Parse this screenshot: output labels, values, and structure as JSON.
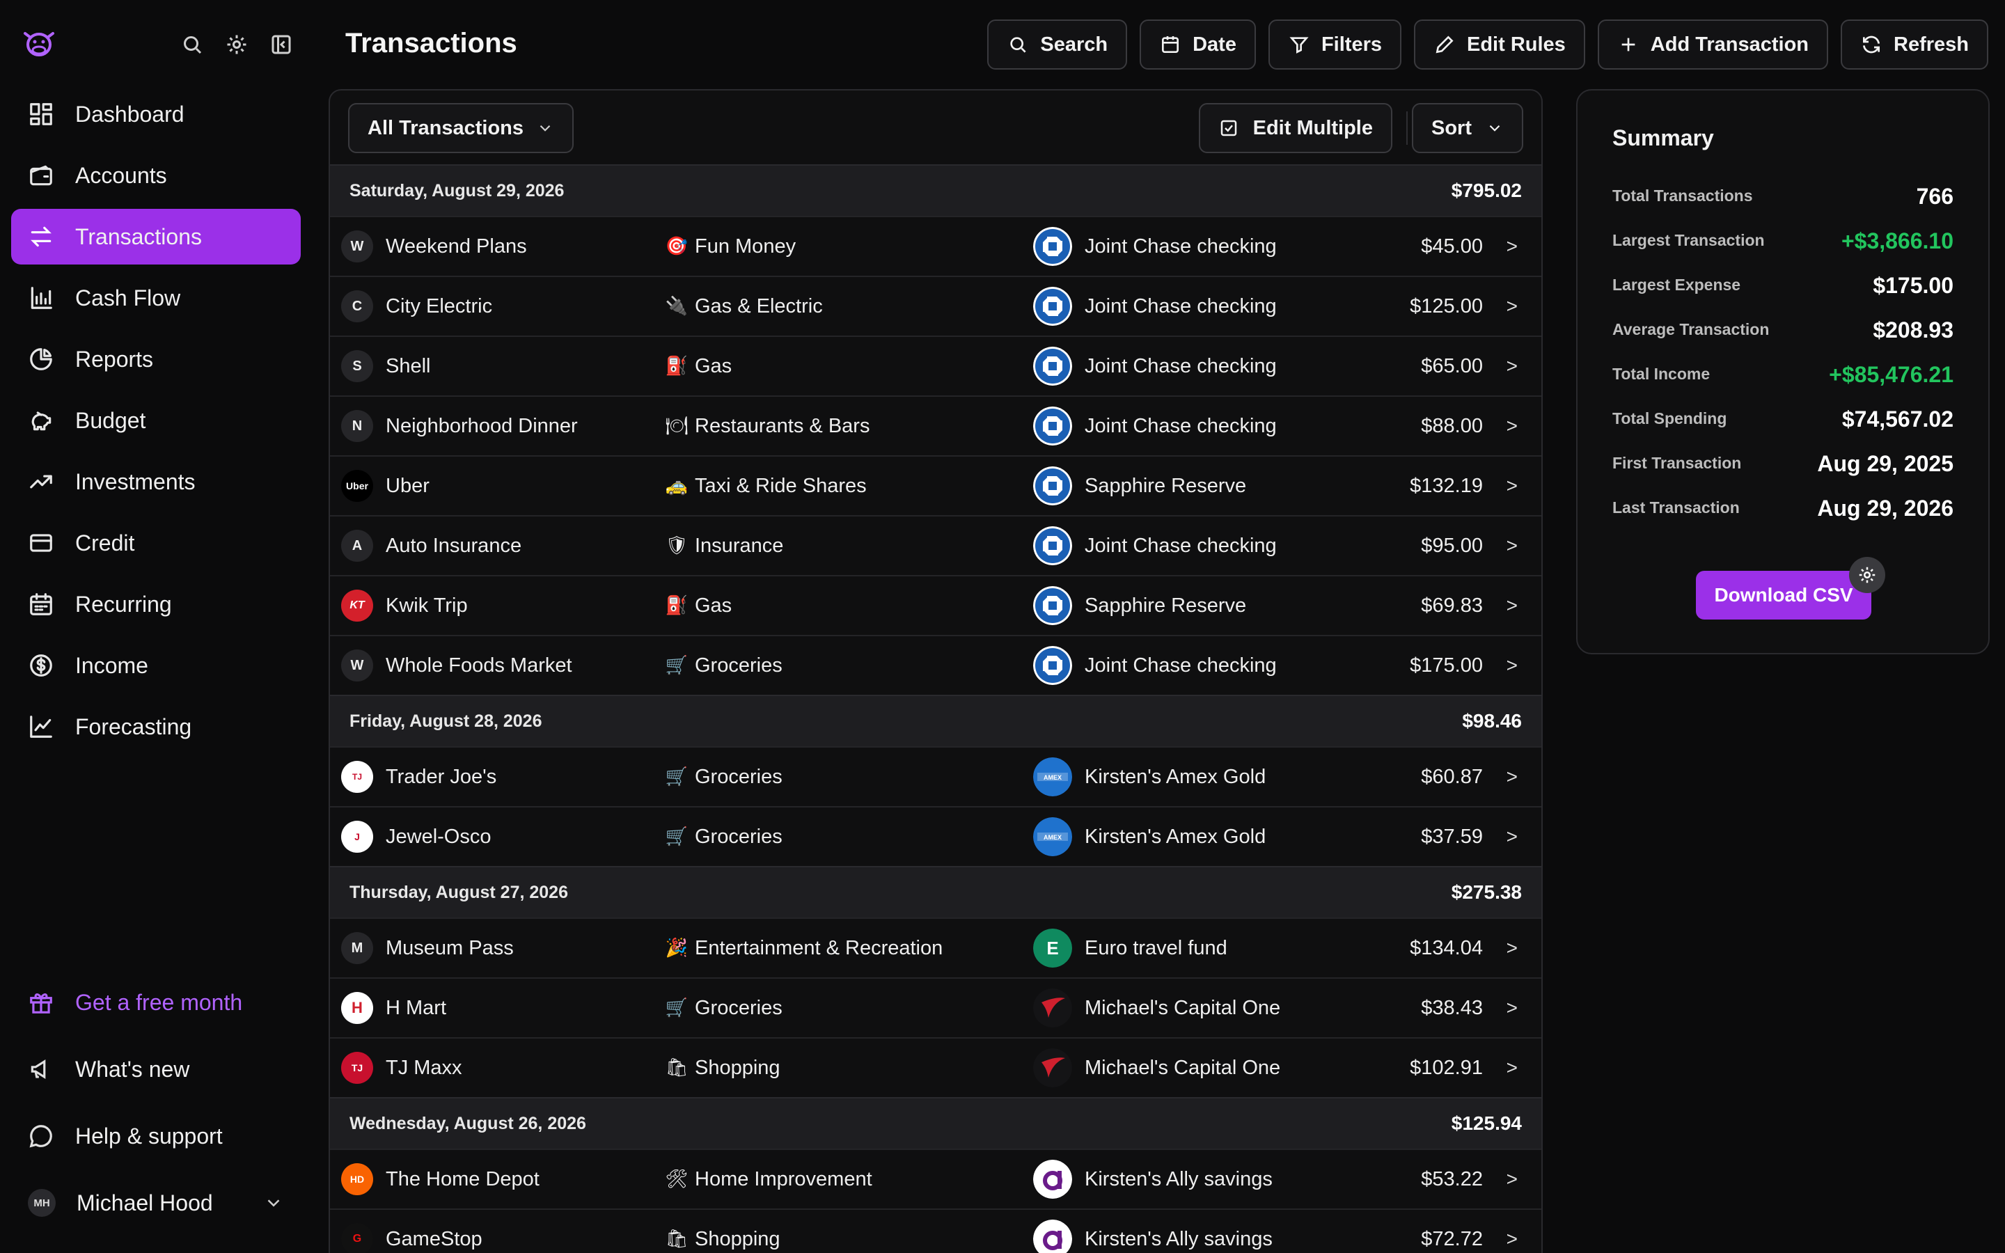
{
  "page": {
    "title": "Transactions"
  },
  "colors": {
    "accent": "#9b30e8",
    "positive": "#22c55e",
    "promo": "#b163ff"
  },
  "sidebar": {
    "items": [
      {
        "label": "Dashboard",
        "icon": "dashboard-icon"
      },
      {
        "label": "Accounts",
        "icon": "wallet-icon"
      },
      {
        "label": "Transactions",
        "icon": "arrows-icon",
        "active": true
      },
      {
        "label": "Cash Flow",
        "icon": "bar-chart-icon"
      },
      {
        "label": "Reports",
        "icon": "pie-chart-icon"
      },
      {
        "label": "Budget",
        "icon": "piggy-bank-icon"
      },
      {
        "label": "Investments",
        "icon": "trending-up-icon"
      },
      {
        "label": "Credit",
        "icon": "credit-card-icon"
      },
      {
        "label": "Recurring",
        "icon": "calendar-icon"
      },
      {
        "label": "Income",
        "icon": "dollar-circle-icon"
      },
      {
        "label": "Forecasting",
        "icon": "line-chart-icon"
      }
    ],
    "bottom": {
      "promo": "Get a free month",
      "whats_new": "What's new",
      "help": "Help & support",
      "user_name": "Michael Hood",
      "user_initials": "MH"
    }
  },
  "toolbar": {
    "search": "Search",
    "date": "Date",
    "filters": "Filters",
    "edit_rules": "Edit Rules",
    "add_transaction": "Add Transaction",
    "refresh": "Refresh"
  },
  "panel": {
    "filter_dropdown": "All Transactions",
    "edit_multiple": "Edit Multiple",
    "sort": "Sort"
  },
  "groups": [
    {
      "date": "Saturday, August 29, 2026",
      "total": "$795.02",
      "rows": [
        {
          "merchant": "Weekend Plans",
          "initial": "W",
          "category": "Fun Money",
          "cat_icon": "🎯",
          "account": "Joint Chase checking",
          "bank": "chase",
          "amount": "$45.00"
        },
        {
          "merchant": "City Electric",
          "initial": "C",
          "category": "Gas & Electric",
          "cat_icon": "🔌",
          "account": "Joint Chase checking",
          "bank": "chase",
          "amount": "$125.00"
        },
        {
          "merchant": "Shell",
          "initial": "S",
          "category": "Gas",
          "cat_icon": "⛽",
          "account": "Joint Chase checking",
          "bank": "chase",
          "amount": "$65.00"
        },
        {
          "merchant": "Neighborhood Dinner",
          "initial": "N",
          "category": "Restaurants & Bars",
          "cat_icon": "🍽",
          "account": "Joint Chase checking",
          "bank": "chase",
          "amount": "$88.00"
        },
        {
          "merchant": "Uber",
          "initial": "Uber",
          "category": "Taxi & Ride Shares",
          "cat_icon": "🚕",
          "account": "Sapphire Reserve",
          "bank": "chase",
          "amount": "$132.19"
        },
        {
          "merchant": "Auto Insurance",
          "initial": "A",
          "category": "Insurance",
          "cat_icon": "🛡",
          "account": "Joint Chase checking",
          "bank": "chase",
          "amount": "$95.00"
        },
        {
          "merchant": "Kwik Trip",
          "initial": "KT",
          "category": "Gas",
          "cat_icon": "⛽",
          "account": "Sapphire Reserve",
          "bank": "chase",
          "amount": "$69.83"
        },
        {
          "merchant": "Whole Foods Market",
          "initial": "W",
          "category": "Groceries",
          "cat_icon": "🛒",
          "account": "Joint Chase checking",
          "bank": "chase",
          "amount": "$175.00"
        }
      ]
    },
    {
      "date": "Friday, August 28, 2026",
      "total": "$98.46",
      "rows": [
        {
          "merchant": "Trader Joe's",
          "initial": "TJ",
          "category": "Groceries",
          "cat_icon": "🛒",
          "account": "Kirsten's Amex Gold",
          "bank": "amex",
          "amount": "$60.87"
        },
        {
          "merchant": "Jewel-Osco",
          "initial": "J",
          "category": "Groceries",
          "cat_icon": "🛒",
          "account": "Kirsten's Amex Gold",
          "bank": "amex",
          "amount": "$37.59"
        }
      ]
    },
    {
      "date": "Thursday, August 27, 2026",
      "total": "$275.38",
      "rows": [
        {
          "merchant": "Museum Pass",
          "initial": "M",
          "category": "Entertainment & Recreation",
          "cat_icon": "🎉",
          "account": "Euro travel fund",
          "bank": "euro",
          "amount": "$134.04"
        },
        {
          "merchant": "H Mart",
          "initial": "H",
          "category": "Groceries",
          "cat_icon": "🛒",
          "account": "Michael's Capital One",
          "bank": "capone",
          "amount": "$38.43"
        },
        {
          "merchant": "TJ Maxx",
          "initial": "TJ",
          "category": "Shopping",
          "cat_icon": "🛍",
          "account": "Michael's Capital One",
          "bank": "capone",
          "amount": "$102.91"
        }
      ]
    },
    {
      "date": "Wednesday, August 26, 2026",
      "total": "$125.94",
      "rows": [
        {
          "merchant": "The Home Depot",
          "initial": "HD",
          "category": "Home Improvement",
          "cat_icon": "🛠",
          "account": "Kirsten's Ally savings",
          "bank": "ally",
          "amount": "$53.22"
        },
        {
          "merchant": "GameStop",
          "initial": "G",
          "category": "Shopping",
          "cat_icon": "🛍",
          "account": "Kirsten's Ally savings",
          "bank": "ally",
          "amount": "$72.72"
        }
      ]
    }
  ],
  "summary": {
    "title": "Summary",
    "stats": [
      {
        "label": "Total Transactions",
        "value": "766",
        "positive": false
      },
      {
        "label": "Largest Transaction",
        "value": "+$3,866.10",
        "positive": true
      },
      {
        "label": "Largest Expense",
        "value": "$175.00",
        "positive": false
      },
      {
        "label": "Average Transaction",
        "value": "$208.93",
        "positive": false
      },
      {
        "label": "Total Income",
        "value": "+$85,476.21",
        "positive": true
      },
      {
        "label": "Total Spending",
        "value": "$74,567.02",
        "positive": false
      },
      {
        "label": "First Transaction",
        "value": "Aug 29, 2025",
        "positive": false
      },
      {
        "label": "Last Transaction",
        "value": "Aug 29, 2026",
        "positive": false
      }
    ],
    "download_label": "Download CSV"
  }
}
